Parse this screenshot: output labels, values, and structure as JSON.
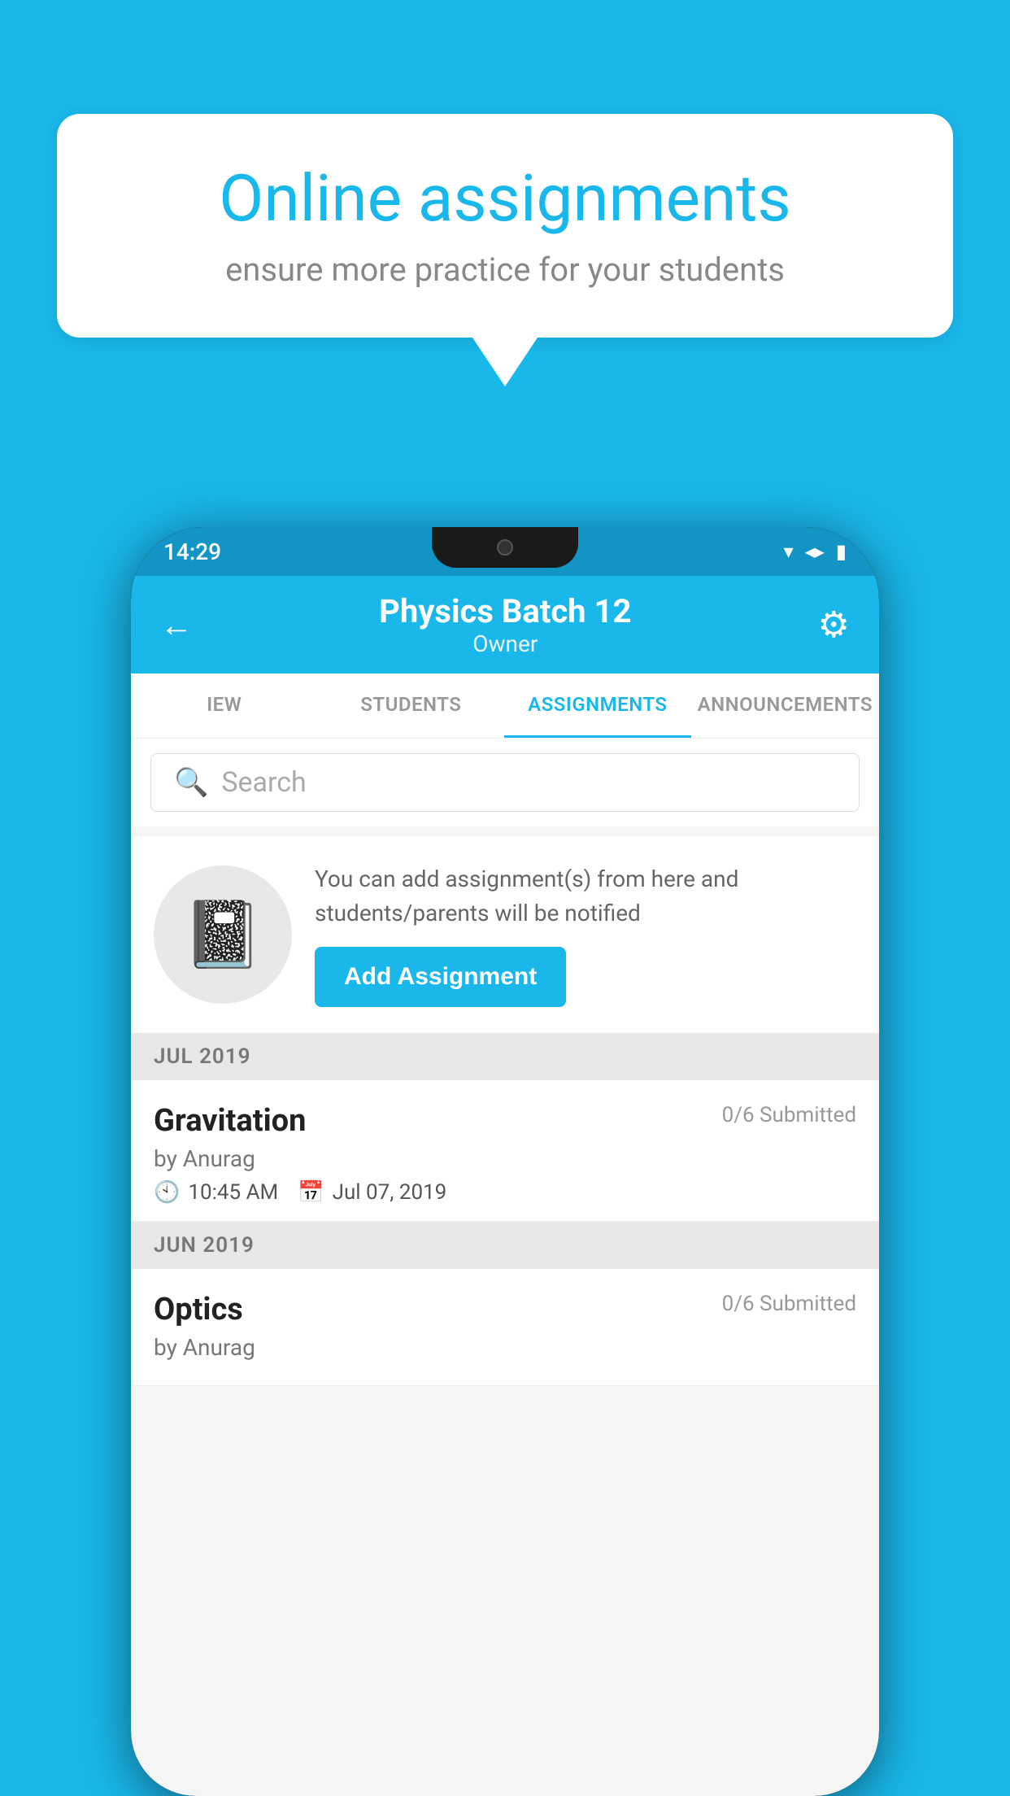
{
  "background_color": "#1ab7ea",
  "speech_bubble": {
    "title": "Online assignments",
    "subtitle": "ensure more practice for your students"
  },
  "status_bar": {
    "time": "14:29",
    "signal_icon": "▲",
    "wifi_icon": "▼",
    "battery_icon": "▮"
  },
  "app_header": {
    "title": "Physics Batch 12",
    "subtitle": "Owner",
    "back_label": "←",
    "gear_label": "⚙"
  },
  "tabs": [
    {
      "id": "iew",
      "label": "IEW",
      "active": false
    },
    {
      "id": "students",
      "label": "STUDENTS",
      "active": false
    },
    {
      "id": "assignments",
      "label": "ASSIGNMENTS",
      "active": true
    },
    {
      "id": "announcements",
      "label": "ANNOUNCEMENTS",
      "active": false
    }
  ],
  "search": {
    "placeholder": "Search"
  },
  "promo": {
    "text": "You can add assignment(s) from here and students/parents will be notified",
    "button_label": "Add Assignment"
  },
  "sections": [
    {
      "label": "JUL 2019",
      "assignments": [
        {
          "name": "Gravitation",
          "submitted": "0/6 Submitted",
          "by": "by Anurag",
          "time": "10:45 AM",
          "date": "Jul 07, 2019"
        }
      ]
    },
    {
      "label": "JUN 2019",
      "assignments": [
        {
          "name": "Optics",
          "submitted": "0/6 Submitted",
          "by": "by Anurag",
          "time": "",
          "date": ""
        }
      ]
    }
  ]
}
